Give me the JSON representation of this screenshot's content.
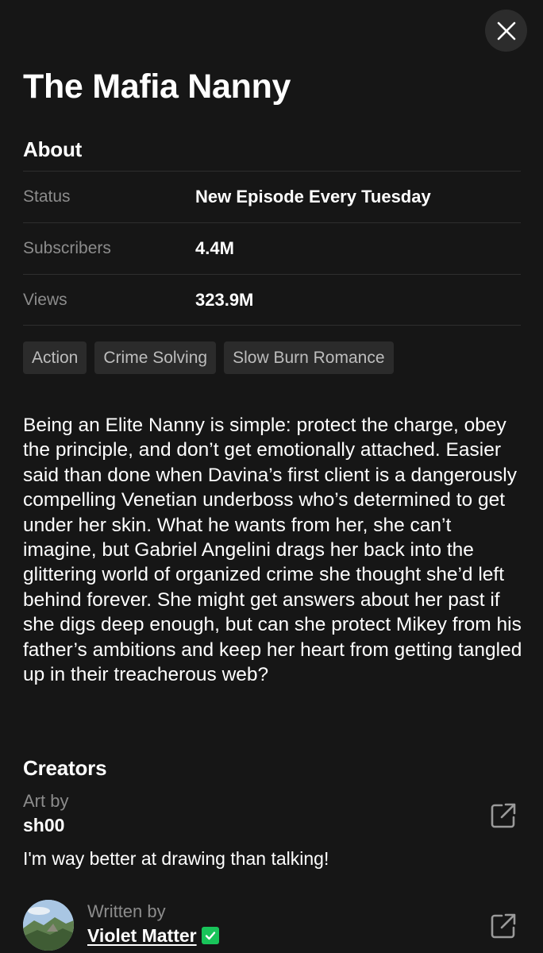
{
  "header": {
    "title": "The Mafia Nanny"
  },
  "about": {
    "heading": "About",
    "rows": [
      {
        "label": "Status",
        "value": "New Episode Every Tuesday"
      },
      {
        "label": "Subscribers",
        "value": "4.4M"
      },
      {
        "label": "Views",
        "value": "323.9M"
      }
    ],
    "tags": [
      "Action",
      "Crime Solving",
      "Slow Burn Romance"
    ],
    "synopsis": "Being an Elite Nanny is simple: protect the charge, obey the principle, and don’t get emotionally attached. Easier said than done when Davina’s first client is a dangerously compelling Venetian underboss who’s determined to get under her skin. What he wants from her, she can’t imagine, but Gabriel Angelini drags her back into the glittering world of organized crime she thought she’d left behind forever. She might get answers about her past if she digs deep enough, but can she protect Mikey from his father’s ambitions and keep her heart from getting tangled up in their treacherous web?"
  },
  "creators": {
    "heading": "Creators",
    "items": [
      {
        "role": "Art by",
        "name": "sh00",
        "bio": "I'm way better at drawing than talking!",
        "link_icon": "external-link-icon"
      },
      {
        "role": "Written by",
        "name": "Violet Matter",
        "verified": true,
        "verified_color": "#19c45a",
        "link_icon": "external-link-icon"
      }
    ]
  },
  "icons": {
    "close": "close-icon"
  },
  "colors": {
    "background": "#161616",
    "tag_background": "#2b2b2b",
    "muted_text": "#8c8c8c"
  }
}
